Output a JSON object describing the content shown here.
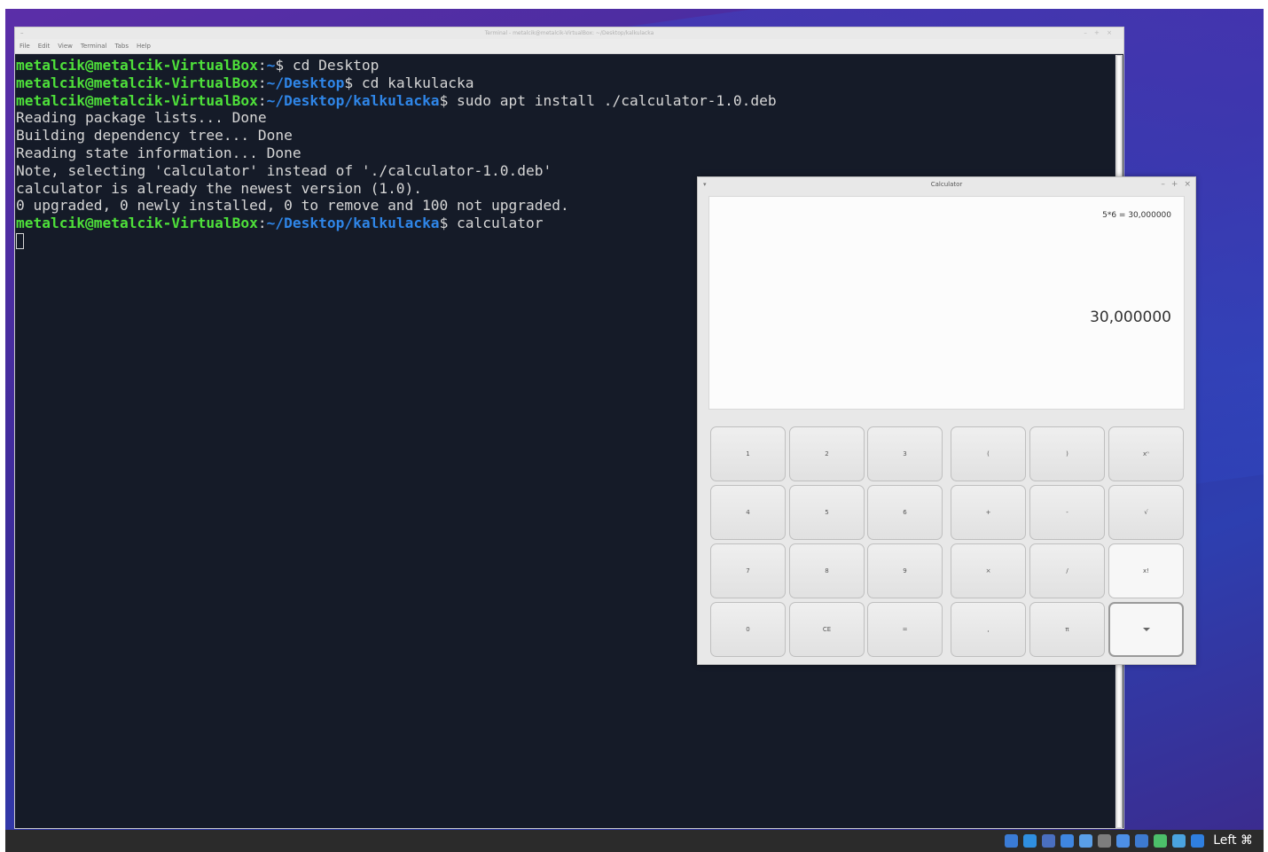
{
  "terminal": {
    "title": "Terminal - metalcik@metalcik-VirtualBox: ~/Desktop/kalkulacka",
    "window_menu_glyph": "–",
    "window_controls": "– + ×",
    "menu": [
      "File",
      "Edit",
      "View",
      "Terminal",
      "Tabs",
      "Help"
    ],
    "lines": [
      {
        "user": "metalcik@metalcik-VirtualBox",
        "path": "~",
        "cmd": " cd Desktop"
      },
      {
        "user": "metalcik@metalcik-VirtualBox",
        "path": "~/Desktop",
        "cmd": " cd kalkulacka"
      },
      {
        "user": "metalcik@metalcik-VirtualBox",
        "path": "~/Desktop/kalkulacka",
        "cmd": " sudo apt install ./calculator-1.0.deb"
      },
      {
        "text": "Reading package lists... Done"
      },
      {
        "text": "Building dependency tree... Done"
      },
      {
        "text": "Reading state information... Done"
      },
      {
        "text": "Note, selecting 'calculator' instead of './calculator-1.0.deb'"
      },
      {
        "text": "calculator is already the newest version (1.0)."
      },
      {
        "text": "0 upgraded, 0 newly installed, 0 to remove and 100 not upgraded."
      },
      {
        "user": "metalcik@metalcik-VirtualBox",
        "path": "~/Desktop/kalkulacka",
        "cmd": " calculator"
      }
    ]
  },
  "calculator": {
    "title": "Calculator",
    "menu_glyph": "▾",
    "controls": [
      "–",
      "+",
      "×"
    ],
    "history": "5*6 = 30,000000",
    "result": "30,000000",
    "keys": [
      [
        "1",
        "2",
        "3",
        "(",
        ")",
        "xⁿ"
      ],
      [
        "4",
        "5",
        "6",
        "+",
        "-",
        "√"
      ],
      [
        "7",
        "8",
        "9",
        "×",
        "/",
        "x!"
      ],
      [
        "0",
        "CE",
        "=",
        ",",
        "π",
        ""
      ]
    ]
  },
  "taskbar": {
    "keyboard_label": "Left ⌘",
    "tray_icons": [
      "hard-disk-icon",
      "optical-disc-icon",
      "audio-icon",
      "network-icon",
      "usb-icon",
      "shared-folder-icon",
      "display-icon",
      "clipboard-icon",
      "recording-icon",
      "globe-icon",
      "download-icon"
    ]
  }
}
